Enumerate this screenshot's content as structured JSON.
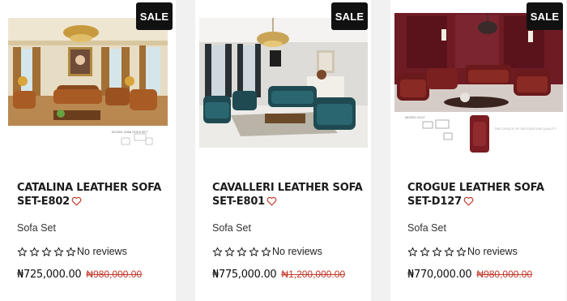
{
  "colors": {
    "sale_bg": "#111111",
    "heart": "#c0392b",
    "old_price": "#c0392b"
  },
  "icons": {
    "wishlist": "heart-outline-icon",
    "rating": "star-outline-icon"
  },
  "products": [
    {
      "sale": "SALE",
      "title": "CATALINA LEATHER SOFA SET-E802",
      "category": "Sofa Set",
      "rating": 0,
      "reviews": "No reviews",
      "price": "₦725,000.00",
      "old_price": "₦980,000.00",
      "image_caption": "MODEL 5368 SOFA SET"
    },
    {
      "sale": "SALE",
      "title": "CAVALLERI LEATHER SOFA SET-E801",
      "category": "Sofa Set",
      "rating": 0,
      "reviews": "No reviews",
      "price": "₦775,000.00",
      "old_price": "₦1,200,000.00"
    },
    {
      "sale": "SALE",
      "title": "CROGUE LEATHER SOFA SET-D127",
      "category": "Sofa Set",
      "rating": 0,
      "reviews": "No reviews",
      "price": "₦770,000.00",
      "old_price": "₦980,000.00",
      "image_caption": "THE CHOICE OF DECORATION QUALITY"
    }
  ]
}
